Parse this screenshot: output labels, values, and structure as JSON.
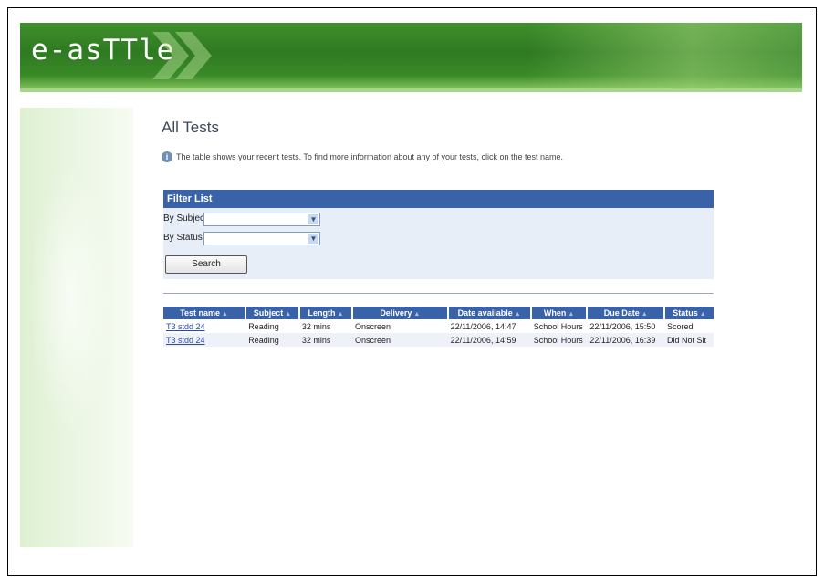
{
  "app": {
    "logo": "e-asTTle"
  },
  "page": {
    "title": "All Tests",
    "info": "The table shows your recent tests. To find more information about any of your tests, click on the test name."
  },
  "filter": {
    "heading": "Filter List",
    "subject_label": "By Subject",
    "subject_value": "",
    "status_label": "By Status",
    "status_value": "",
    "search_button": "Search"
  },
  "table": {
    "columns": [
      "Test name",
      "Subject",
      "Length",
      "Delivery",
      "Date available",
      "When",
      "Due Date",
      "Status"
    ],
    "rows": [
      {
        "name": "T3 stdd 24",
        "subject": "Reading",
        "length": "32 mins",
        "delivery": "Onscreen",
        "date_available": "22/11/2006, 14:47",
        "when": "School Hours",
        "due_date": "22/11/2006, 15:50",
        "status": "Scored"
      },
      {
        "name": "T3 stdd 24",
        "subject": "Reading",
        "length": "32 mins",
        "delivery": "Onscreen",
        "date_available": "22/11/2006, 14:59",
        "when": "School Hours",
        "due_date": "22/11/2006, 16:39",
        "status": "Did Not Sit"
      }
    ]
  },
  "colors": {
    "header_green": "#2f7a22",
    "table_header_blue": "#3a62a8",
    "filter_bg": "#e8eef7",
    "link": "#2c49b0"
  }
}
